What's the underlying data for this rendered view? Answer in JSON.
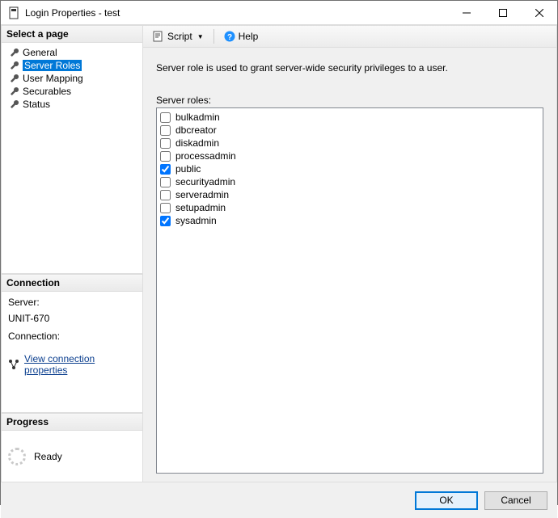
{
  "window": {
    "title": "Login Properties - test"
  },
  "sidebar": {
    "select_header": "Select a page",
    "items": [
      {
        "label": "General",
        "selected": false
      },
      {
        "label": "Server Roles",
        "selected": true
      },
      {
        "label": "User Mapping",
        "selected": false
      },
      {
        "label": "Securables",
        "selected": false
      },
      {
        "label": "Status",
        "selected": false
      }
    ]
  },
  "connection": {
    "header": "Connection",
    "server_label": "Server:",
    "server_value": "UNIT-670",
    "connection_label": "Connection:",
    "connection_value": "",
    "view_link": "View connection properties"
  },
  "progress": {
    "header": "Progress",
    "status": "Ready"
  },
  "toolbar": {
    "script_label": "Script",
    "help_label": "Help"
  },
  "main": {
    "description": "Server role is used to grant server-wide security privileges to a user.",
    "roles_label": "Server roles:",
    "roles": [
      {
        "name": "bulkadmin",
        "checked": false
      },
      {
        "name": "dbcreator",
        "checked": false
      },
      {
        "name": "diskadmin",
        "checked": false
      },
      {
        "name": "processadmin",
        "checked": false
      },
      {
        "name": "public",
        "checked": true
      },
      {
        "name": "securityadmin",
        "checked": false
      },
      {
        "name": "serveradmin",
        "checked": false
      },
      {
        "name": "setupadmin",
        "checked": false
      },
      {
        "name": "sysadmin",
        "checked": true
      }
    ]
  },
  "buttons": {
    "ok": "OK",
    "cancel": "Cancel"
  }
}
